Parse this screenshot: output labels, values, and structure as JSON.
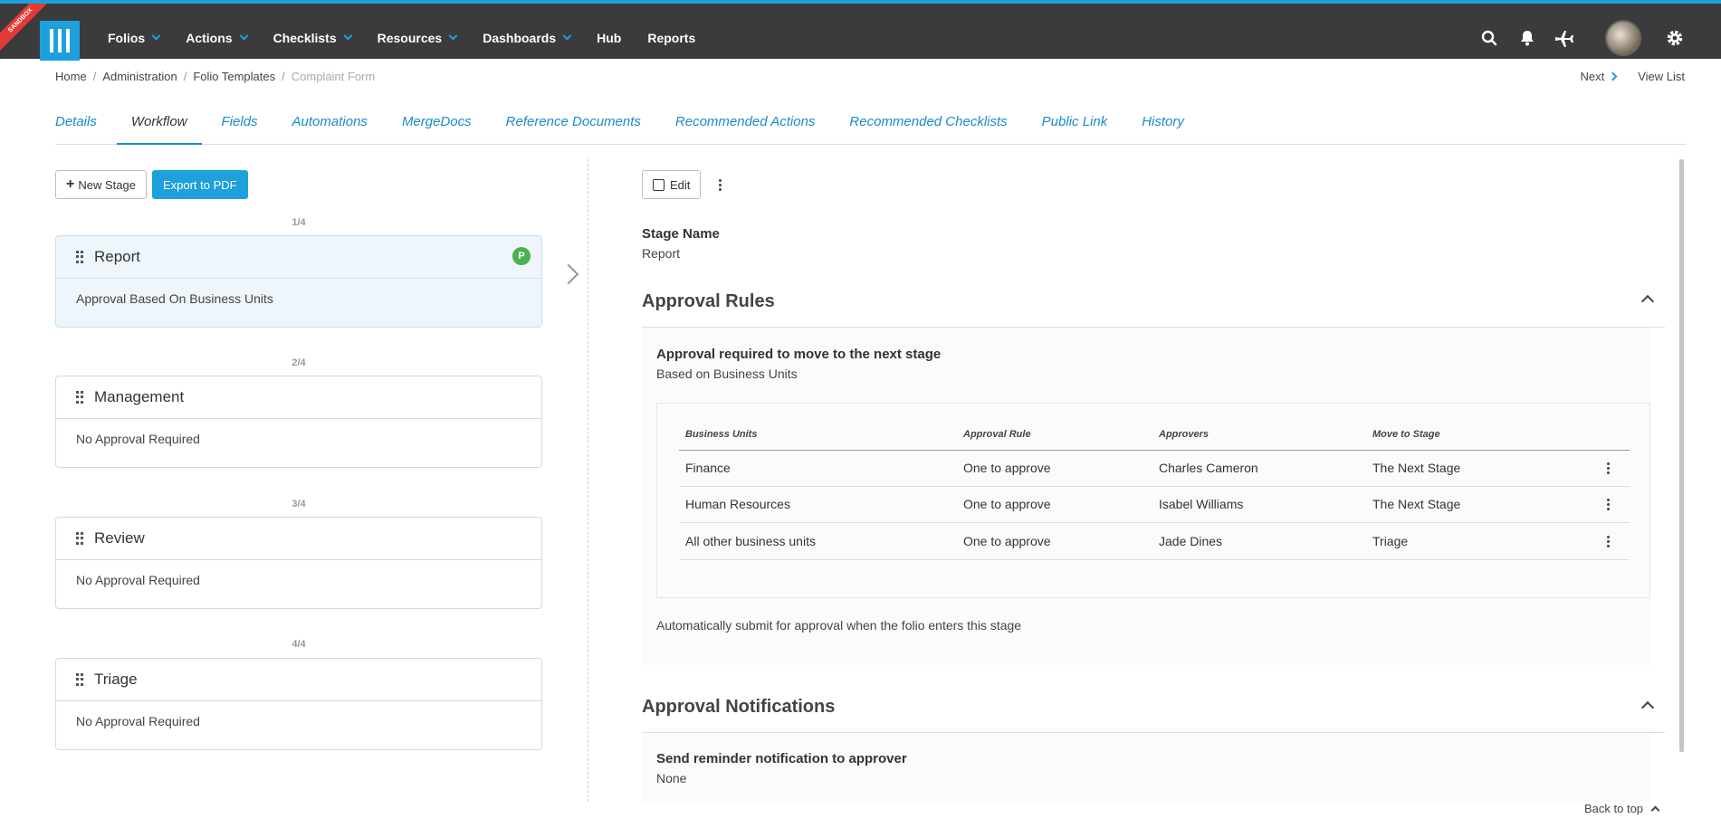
{
  "topbar": {
    "sandbox_label": "SANDBOX",
    "nav": [
      {
        "label": "Folios",
        "has_dropdown": true
      },
      {
        "label": "Actions",
        "has_dropdown": true
      },
      {
        "label": "Checklists",
        "has_dropdown": true
      },
      {
        "label": "Resources",
        "has_dropdown": true
      },
      {
        "label": "Dashboards",
        "has_dropdown": true
      },
      {
        "label": "Hub",
        "has_dropdown": false
      },
      {
        "label": "Reports",
        "has_dropdown": false
      }
    ],
    "icons": [
      "search-icon",
      "bell-icon",
      "plane-icon",
      "avatar",
      "gear-icon"
    ]
  },
  "breadcrumb": {
    "items": [
      "Home",
      "Administration",
      "Folio Templates"
    ],
    "current": "Complaint Form"
  },
  "top_links": {
    "next": "Next",
    "view_list": "View List"
  },
  "tabs": [
    {
      "label": "Details",
      "active": false
    },
    {
      "label": "Workflow",
      "active": true
    },
    {
      "label": "Fields",
      "active": false
    },
    {
      "label": "Automations",
      "active": false
    },
    {
      "label": "MergeDocs",
      "active": false
    },
    {
      "label": "Reference Documents",
      "active": false
    },
    {
      "label": "Recommended Actions",
      "active": false
    },
    {
      "label": "Recommended Checklists",
      "active": false
    },
    {
      "label": "Public Link",
      "active": false
    },
    {
      "label": "History",
      "active": false
    }
  ],
  "left": {
    "new_stage_label": "New Stage",
    "export_label": "Export to PDF",
    "stages": [
      {
        "count": "1/4",
        "name": "Report",
        "desc": "Approval Based On Business Units",
        "badge": "P",
        "active": true
      },
      {
        "count": "2/4",
        "name": "Management",
        "desc": "No Approval Required",
        "badge": "",
        "active": false
      },
      {
        "count": "3/4",
        "name": "Review",
        "desc": "No Approval Required",
        "badge": "",
        "active": false
      },
      {
        "count": "4/4",
        "name": "Triage",
        "desc": "No Approval Required",
        "badge": "",
        "active": false
      }
    ]
  },
  "right": {
    "edit_label": "Edit",
    "stage_name_label": "Stage Name",
    "stage_name_value": "Report",
    "approval_rules": {
      "title": "Approval Rules",
      "rule_title": "Approval required to move to the next stage",
      "rule_sub": "Based on Business Units",
      "table": {
        "headers": [
          "Business Units",
          "Approval Rule",
          "Approvers",
          "Move to Stage"
        ],
        "rows": [
          [
            "Finance",
            "One to approve",
            "Charles Cameron",
            "The Next Stage"
          ],
          [
            "Human Resources",
            "One to approve",
            "Isabel Williams",
            "The Next Stage"
          ],
          [
            "All other business units",
            "One to approve",
            "Jade Dines",
            "Triage"
          ]
        ]
      },
      "auto_submit": "Automatically submit for approval when the folio enters this stage"
    },
    "approval_notifications": {
      "title": "Approval Notifications",
      "reminder_label": "Send reminder notification to approver",
      "reminder_value": "None"
    }
  },
  "back_to_top": "Back to top",
  "colors": {
    "accent": "#1ea0dc",
    "topbar": "#3b3b3b",
    "badge": "#4caf50",
    "sandbox": "#e53935"
  }
}
